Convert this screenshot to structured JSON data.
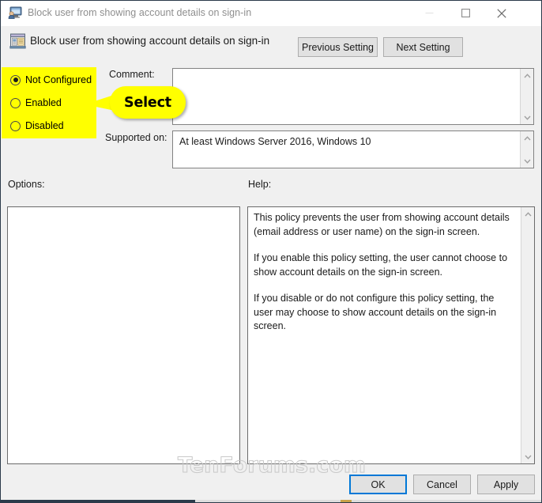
{
  "window": {
    "title": "Block user from showing account details on sign-in",
    "icon": "monitor-user-icon",
    "controls": {
      "minimize": "minimize-icon",
      "maximize": "maximize-icon",
      "close": "close-icon"
    }
  },
  "header": {
    "icon": "policy-setting-icon",
    "title": "Block user from showing account details on sign-in",
    "previous_label": "Previous Setting",
    "next_label": "Next Setting"
  },
  "state": {
    "options": [
      {
        "label": "Not Configured",
        "selected": true
      },
      {
        "label": "Enabled",
        "selected": false
      },
      {
        "label": "Disabled",
        "selected": false
      }
    ]
  },
  "comment": {
    "label": "Comment:",
    "value": ""
  },
  "supported": {
    "label": "Supported on:",
    "value": "At least Windows Server 2016, Windows 10"
  },
  "panels": {
    "options_label": "Options:",
    "help_label": "Help:",
    "options_content": "",
    "help_paragraphs": [
      "This policy prevents the user from showing account details (email address or user name) on the sign-in screen.",
      "If you enable this policy setting, the user cannot choose to show account details on the sign-in screen.",
      "If you disable or do not configure this policy setting, the user may choose to show account details on the sign-in screen."
    ]
  },
  "footer": {
    "ok_label": "OK",
    "cancel_label": "Cancel",
    "apply_label": "Apply"
  },
  "annotation": {
    "callout_label": "Select"
  },
  "watermark": {
    "text": "TenForums.com"
  },
  "colors": {
    "highlight": "#ffff00",
    "focus_border": "#0078d7",
    "window_chrome": "#f0f0f0",
    "title_text": "#8e8e8e"
  }
}
